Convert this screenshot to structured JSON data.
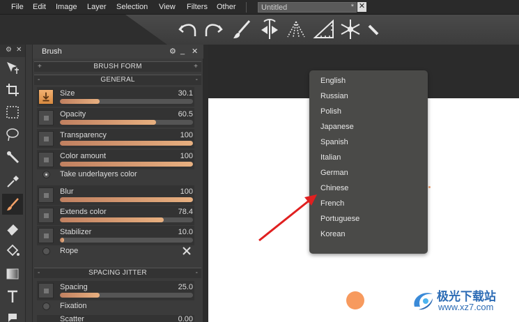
{
  "menubar": {
    "items": [
      "File",
      "Edit",
      "Image",
      "Layer",
      "Selection",
      "View",
      "Filters",
      "Other"
    ],
    "document_tab": "Untitled",
    "document_modified_mark": "*",
    "document_close": "✕"
  },
  "toolbar": {
    "icons": [
      "undo-icon",
      "redo-icon",
      "brush-icon",
      "symmetry-icon",
      "perspective-icon",
      "ruler-triangle-icon",
      "snowflake-icon",
      "small-ruler-icon"
    ]
  },
  "tools_header": {
    "gear": "⚙",
    "close": "✕"
  },
  "tools": [
    "move-icon",
    "crop-icon",
    "marquee-select-icon",
    "lasso-icon",
    "magic-wand-icon",
    "eyedropper-icon",
    "brush-tool-icon",
    "eraser-icon",
    "fill-bucket-icon",
    "gradient-icon",
    "text-tool-icon",
    "smudge-icon"
  ],
  "active_tool": "brush-tool-icon",
  "brush_panel": {
    "title": "Brush",
    "controls": {
      "gear": "⚙",
      "minimize": "_",
      "close": "✕"
    },
    "brush_form_section": {
      "label": "BRUSH FORM",
      "left": "+",
      "right": "+"
    },
    "general_section": {
      "label": "GENERAL",
      "left": "-",
      "right": "-"
    },
    "sliders": [
      {
        "label": "Size",
        "value": "30.1",
        "fill": 0.3,
        "checked": true
      },
      {
        "label": "Opacity",
        "value": "60.5",
        "fill": 0.72,
        "checked": false
      },
      {
        "label": "Transparency",
        "value": "100",
        "fill": 1.0,
        "checked": false
      },
      {
        "label": "Color amount",
        "value": "100",
        "fill": 1.0,
        "checked": false
      }
    ],
    "take_underlayers": "Take underlayers color",
    "sliders2": [
      {
        "label": "Blur",
        "value": "100",
        "fill": 1.0,
        "checked": false
      },
      {
        "label": "Extends color",
        "value": "78.4",
        "fill": 0.78,
        "checked": false
      },
      {
        "label": "Stabilizer",
        "value": "10.0",
        "fill": 0.03,
        "checked": false
      }
    ],
    "rope": "Rope",
    "spacing_section": {
      "label": "SPACING JITTER",
      "left": "-",
      "right": "-"
    },
    "spacing": {
      "label": "Spacing",
      "value": "25.0",
      "fill": 0.3,
      "checked": false
    },
    "fixation": "Fixation",
    "scatter": {
      "label": "Scatter",
      "value": "0.00"
    }
  },
  "language_menu": {
    "items": [
      "English",
      "Russian",
      "Polish",
      "Japanese",
      "Spanish",
      "Italian",
      "German",
      "Chinese",
      "French",
      "Portuguese",
      "Korean"
    ]
  },
  "colors": {
    "accent_orange": "#f79a5e",
    "arrow_red": "#e02020",
    "watermark_blue": "#2d6cb5"
  },
  "watermark": {
    "name": "极光下载站",
    "url": "www.xz7.com"
  }
}
